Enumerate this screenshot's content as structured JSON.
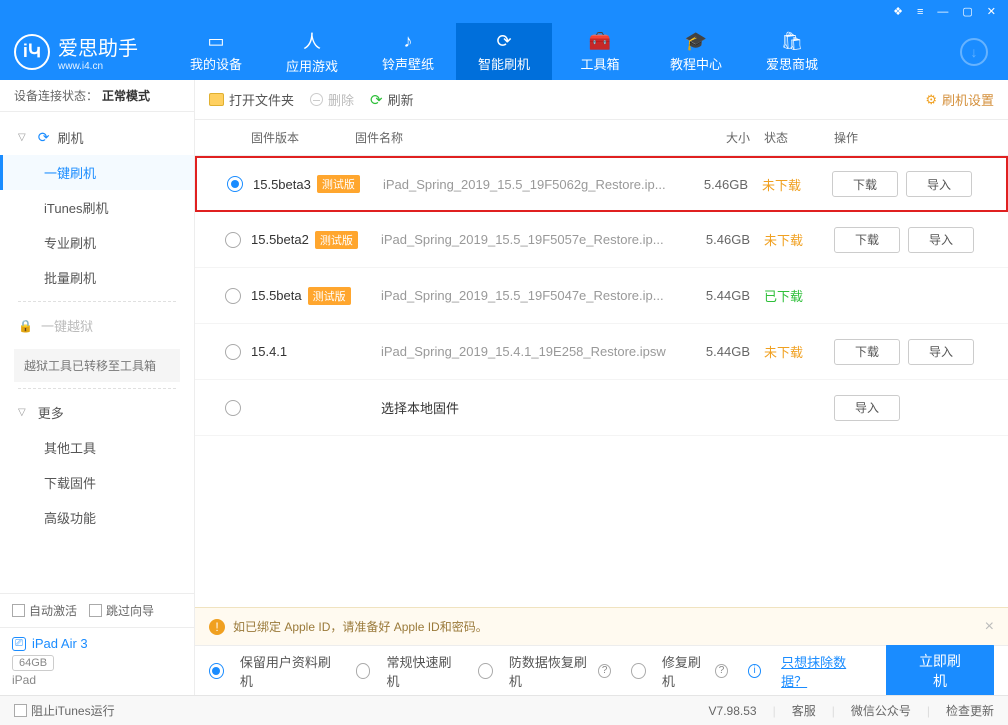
{
  "titlebar": {
    "hint": "window controls"
  },
  "logo": {
    "main": "爱思助手",
    "sub": "www.i4.cn",
    "badge": "iԿ"
  },
  "nav": [
    {
      "label": "我的设备"
    },
    {
      "label": "应用游戏"
    },
    {
      "label": "铃声壁纸"
    },
    {
      "label": "智能刷机",
      "active": true
    },
    {
      "label": "工具箱"
    },
    {
      "label": "教程中心"
    },
    {
      "label": "爱思商城"
    }
  ],
  "connection": {
    "label": "设备连接状态：",
    "value": "正常模式"
  },
  "sidebar": {
    "group1_title": "刷机",
    "group1_items": [
      "一键刷机",
      "iTunes刷机",
      "专业刷机",
      "批量刷机"
    ],
    "locked": "一键越狱",
    "note": "越狱工具已转移至工具箱",
    "group2_title": "更多",
    "group2_items": [
      "其他工具",
      "下载固件",
      "高级功能"
    ],
    "auto_activate": "自动激活",
    "skip_guide": "跳过向导",
    "device_name": "iPad Air 3",
    "device_cap": "64GB",
    "device_model": "iPad"
  },
  "toolbar": {
    "open": "打开文件夹",
    "delete": "删除",
    "refresh": "刷新",
    "settings": "刷机设置"
  },
  "columns": {
    "ver": "固件版本",
    "name": "固件名称",
    "size": "大小",
    "stat": "状态",
    "ops": "操作"
  },
  "ops": {
    "download": "下载",
    "import": "导入"
  },
  "rows": [
    {
      "ver": "15.5beta3",
      "beta": "测试版",
      "name": "iPad_Spring_2019_15.5_19F5062g_Restore.ip...",
      "size": "5.46GB",
      "stat": "未下载",
      "sel": true,
      "hl": true,
      "dl": true
    },
    {
      "ver": "15.5beta2",
      "beta": "测试版",
      "name": "iPad_Spring_2019_15.5_19F5057e_Restore.ip...",
      "size": "5.46GB",
      "stat": "未下载",
      "dl": true
    },
    {
      "ver": "15.5beta",
      "beta": "测试版",
      "name": "iPad_Spring_2019_15.5_19F5047e_Restore.ip...",
      "size": "5.44GB",
      "stat": "已下载",
      "green": true
    },
    {
      "ver": "15.4.1",
      "name": "iPad_Spring_2019_15.4.1_19E258_Restore.ipsw",
      "size": "5.44GB",
      "stat": "未下载",
      "dl": true
    },
    {
      "local": true,
      "name": "选择本地固件",
      "imp": true
    }
  ],
  "notice": "如已绑定 Apple ID，请准备好 Apple ID和密码。",
  "actionbar": {
    "opt1": "保留用户资料刷机",
    "opt2": "常规快速刷机",
    "opt3": "防数据恢复刷机",
    "opt4": "修复刷机",
    "link": "只想抹除数据？",
    "primary": "立即刷机"
  },
  "footer": {
    "block": "阻止iTunes运行",
    "version": "V7.98.53",
    "svc": "客服",
    "wechat": "微信公众号",
    "update": "检查更新"
  }
}
